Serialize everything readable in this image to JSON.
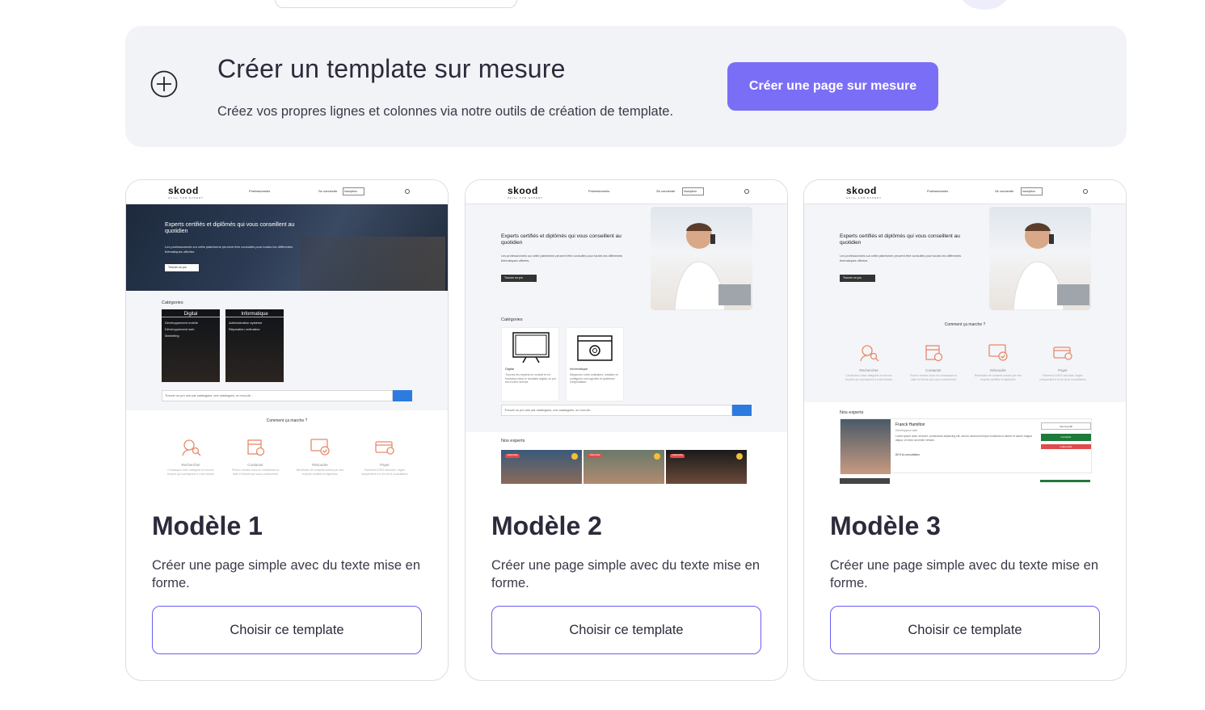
{
  "banner": {
    "title": "Créer un template sur mesure",
    "subtitle": "Créez vos propres lignes et colonnes via notre outils de création de template.",
    "button_label": "Créer une page sur mesure"
  },
  "colors": {
    "accent": "#7b6ef6",
    "card_border_accent": "#6a5ef0",
    "banner_bg": "#f1f3f7",
    "preview_icon": "#e8896a"
  },
  "preview": {
    "logo": "skood",
    "logo_tagline": "SKILL FOR EXPERT",
    "nav_link": "Professionnels",
    "login_link": "Se connecter",
    "select_label": "Inscription",
    "hero_title": "Experts certifiés et diplômés qui vous conseillent au quotidien",
    "hero_text": "Les professionnels sur cette plateforme peuvent être consultés pour toutes les différentes thématiques offertes.",
    "hero_button": "Trouver un pro",
    "categories_label": "Catégories",
    "cat_digital": "Digital",
    "cat_digital_items": [
      "Développement mobile",
      "Développement web",
      "Marketing"
    ],
    "cat_info": "Informatique",
    "cat_info_items": [
      "Administration système",
      "Réparation ordinateur"
    ],
    "search_placeholder": "Trouver un pro une par catalogues, une catalogues, un mot-clé...",
    "how_title": "Comment ça marche ?",
    "steps": [
      {
        "label": "Rechercher",
        "text": "Choisissez votre catégorie et trouvez l'expert qui correspond à votre besoin"
      },
      {
        "label": "Contacter",
        "text": "Prenez rendez-vous en choisissant la date et l'heure qui vous conviennent"
      },
      {
        "label": "Résoudre",
        "text": "Bénéficiez de conseils avisés par des experts certifiés et diplômés"
      },
      {
        "label": "Payer",
        "text": "Paiement 100% sécurisé, réglez uniquement à la fin de la consultation"
      }
    ],
    "cat2_digital": "Digital",
    "cat2_digital_text": "Trouvez les experts en conseil et en formation dans le domaine digital, un pro est à votre service.",
    "cat2_info": "Informatique",
    "cat2_info_text": "Dépannez votre ordinateur, installez et configurez vos logiciels et systèmes d'exploitation.",
    "experts_label": "Nos experts",
    "expert_badge": "Indisponible",
    "expert_name": "Franck Hamilton",
    "expert_role": "Développeur web",
    "expert_bio": "Lorem ipsum dolor sit amet, consectetur adipiscing elit, sed do eiusmod tempor incididunt ut labore et dolore magna aliqua. Ut enim ad minim veniam.",
    "expert_price": "80 € la consultation",
    "expert_btn_profile": "Voir le profil",
    "expert_btn_contact": "Contacter",
    "expert_btn_status": "Indisponible"
  },
  "templates": [
    {
      "title": "Modèle 1",
      "description": "Créer une page simple avec du texte mise en forme.",
      "button_label": "Choisir ce template"
    },
    {
      "title": "Modèle 2",
      "description": "Créer une page simple avec du texte mise en forme.",
      "button_label": "Choisir ce template"
    },
    {
      "title": "Modèle 3",
      "description": "Créer une page simple avec du texte mise en forme.",
      "button_label": "Choisir ce template"
    }
  ]
}
